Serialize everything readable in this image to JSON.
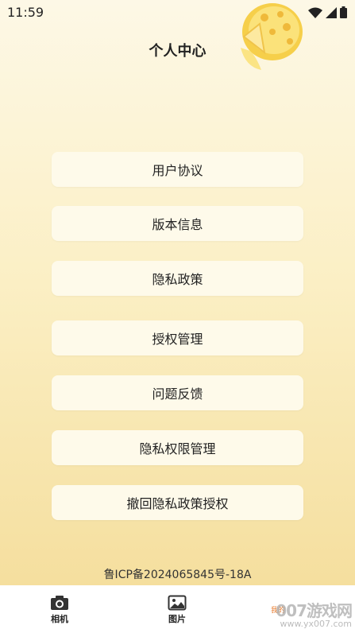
{
  "status_bar": {
    "time": "11:59"
  },
  "page": {
    "title": "个人中心"
  },
  "menu": [
    {
      "label": "用户协议"
    },
    {
      "label": "版本信息"
    },
    {
      "label": "隐私政策"
    },
    {
      "label": "授权管理"
    },
    {
      "label": "问题反馈"
    },
    {
      "label": "隐私权限管理"
    },
    {
      "label": "撤回隐私政策授权"
    }
  ],
  "footer": {
    "icp": "鲁ICP备2024065845号-18A"
  },
  "bottom_nav": [
    {
      "label": "相机",
      "icon": "camera-icon"
    },
    {
      "label": "图片",
      "icon": "picture-icon"
    }
  ],
  "watermark": {
    "main": "007游戏网",
    "sub": "www.yx007.com",
    "badge": "我的"
  },
  "colors": {
    "bg_top": "#fdf8e6",
    "bg_bottom": "#f4dc98",
    "card": "#fefaea",
    "accent": "#f5c443"
  }
}
